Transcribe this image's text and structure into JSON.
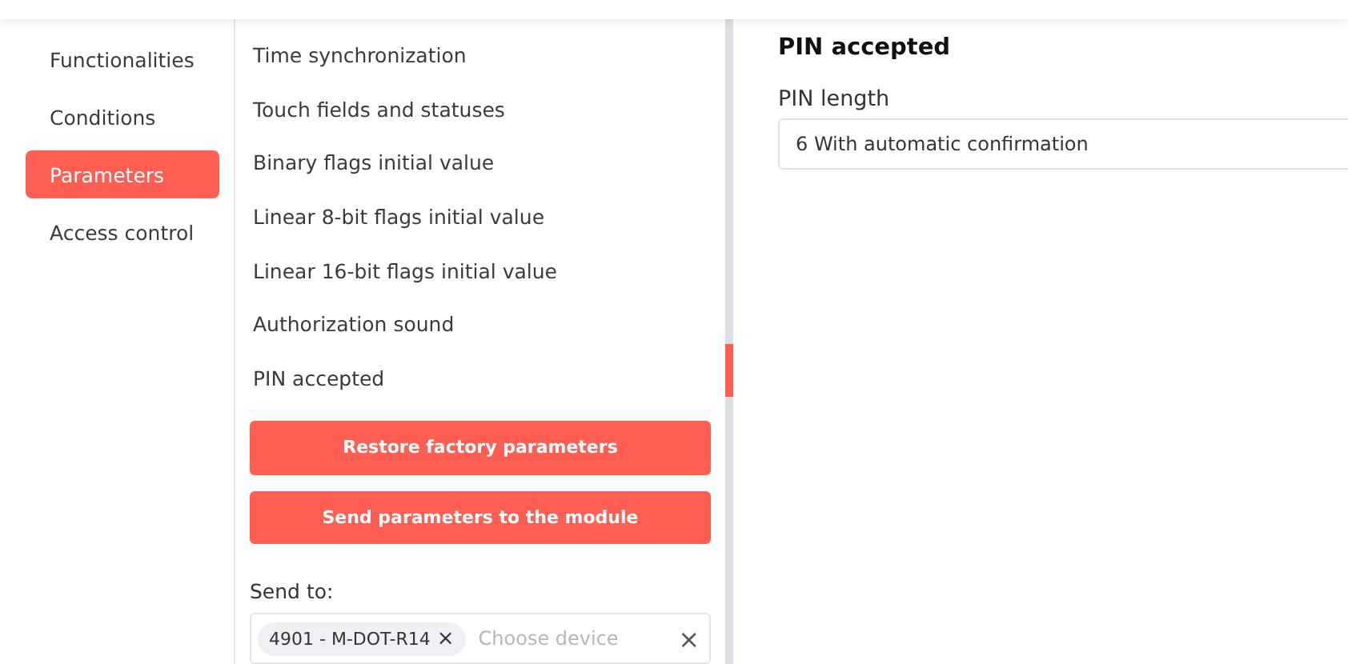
{
  "nav": {
    "items": [
      {
        "label": "Functionalities",
        "selected": false
      },
      {
        "label": "Conditions",
        "selected": false
      },
      {
        "label": "Parameters",
        "selected": true
      },
      {
        "label": "Access control",
        "selected": false
      }
    ]
  },
  "parameters": {
    "items": [
      "Time synchronization",
      "Touch fields and statuses",
      "Binary flags initial value",
      "Linear 8-bit flags initial value",
      "Linear 16-bit flags initial value",
      "Authorization sound",
      "PIN accepted"
    ],
    "buttons": [
      "Restore factory parameters",
      "Send parameters to the module"
    ],
    "send_to": {
      "label": "Send to:",
      "chips": [
        "4901 - M-DOT-R14"
      ],
      "chip_remove": "×",
      "placeholder": "Choose device",
      "clear": "×"
    }
  },
  "detail": {
    "title": "PIN accepted",
    "field": {
      "label": "PIN length",
      "value": "6 With automatic confirmation"
    }
  }
}
